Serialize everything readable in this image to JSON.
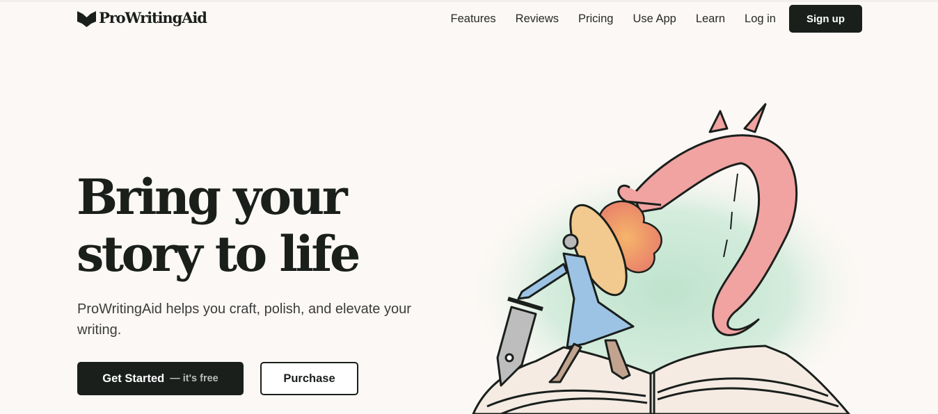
{
  "brand": {
    "name": "ProWritingAid",
    "logo_icon": "open-book-icon"
  },
  "nav": {
    "links": [
      {
        "label": "Features"
      },
      {
        "label": "Reviews"
      },
      {
        "label": "Pricing"
      },
      {
        "label": "Use App"
      },
      {
        "label": "Learn"
      },
      {
        "label": "Log in"
      }
    ],
    "signup_label": "Sign up"
  },
  "hero": {
    "title_line1": "Bring your",
    "title_line2": "story to life",
    "subtitle": "ProWritingAid helps you craft, polish, and elevate your writing.",
    "primary_cta": {
      "label": "Get Started",
      "aside": "— it's free"
    },
    "secondary_cta": {
      "label": "Purchase"
    },
    "illustration": "knight-with-pen-sword-fighting-dragon-on-open-book"
  },
  "colors": {
    "background": "#fcf8f5",
    "ink": "#1a1f1c",
    "dragon": "#f0a3a1",
    "tunic": "#9cc3e4",
    "mist": "#cfe9d9",
    "fire": "#f2a269"
  }
}
